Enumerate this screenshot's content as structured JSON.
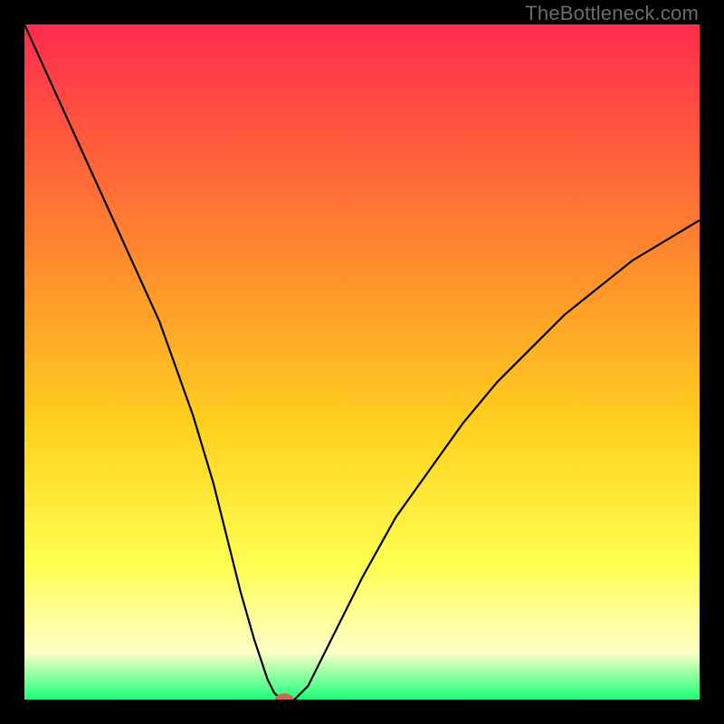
{
  "watermark": "TheBottleneck.com",
  "colors": {
    "frame": "#000000",
    "gradient_top": "#ff2b4e",
    "gradient_mid1": "#ff8b2d",
    "gradient_mid2": "#ffd21f",
    "gradient_mid3": "#ffff52",
    "gradient_mid4": "#fdffc6",
    "gradient_bottom": "#1cff7a",
    "curve": "#000000",
    "marker": "#c96a55"
  },
  "chart_data": {
    "type": "line",
    "title": "",
    "xlabel": "",
    "ylabel": "",
    "xlim": [
      0,
      100
    ],
    "ylim": [
      0,
      100
    ],
    "series": [
      {
        "name": "bottleneck-curve",
        "x": [
          0,
          5,
          10,
          15,
          20,
          25,
          28,
          30,
          32,
          34,
          36,
          37,
          38,
          39,
          40,
          42,
          45,
          50,
          55,
          60,
          65,
          70,
          75,
          80,
          85,
          90,
          95,
          100
        ],
        "y": [
          100,
          89,
          78,
          67,
          56,
          42,
          32,
          24,
          16,
          9,
          3,
          1,
          0,
          0,
          0,
          2,
          8,
          18,
          27,
          34,
          41,
          47,
          52,
          57,
          61,
          65,
          68,
          71
        ]
      }
    ],
    "marker": {
      "name": "optimal-point",
      "x": 38.5,
      "y": 0,
      "rx": 1.4,
      "ry": 0.9
    },
    "flat_segment": {
      "x0": 37,
      "x1": 40,
      "y": 0
    }
  }
}
